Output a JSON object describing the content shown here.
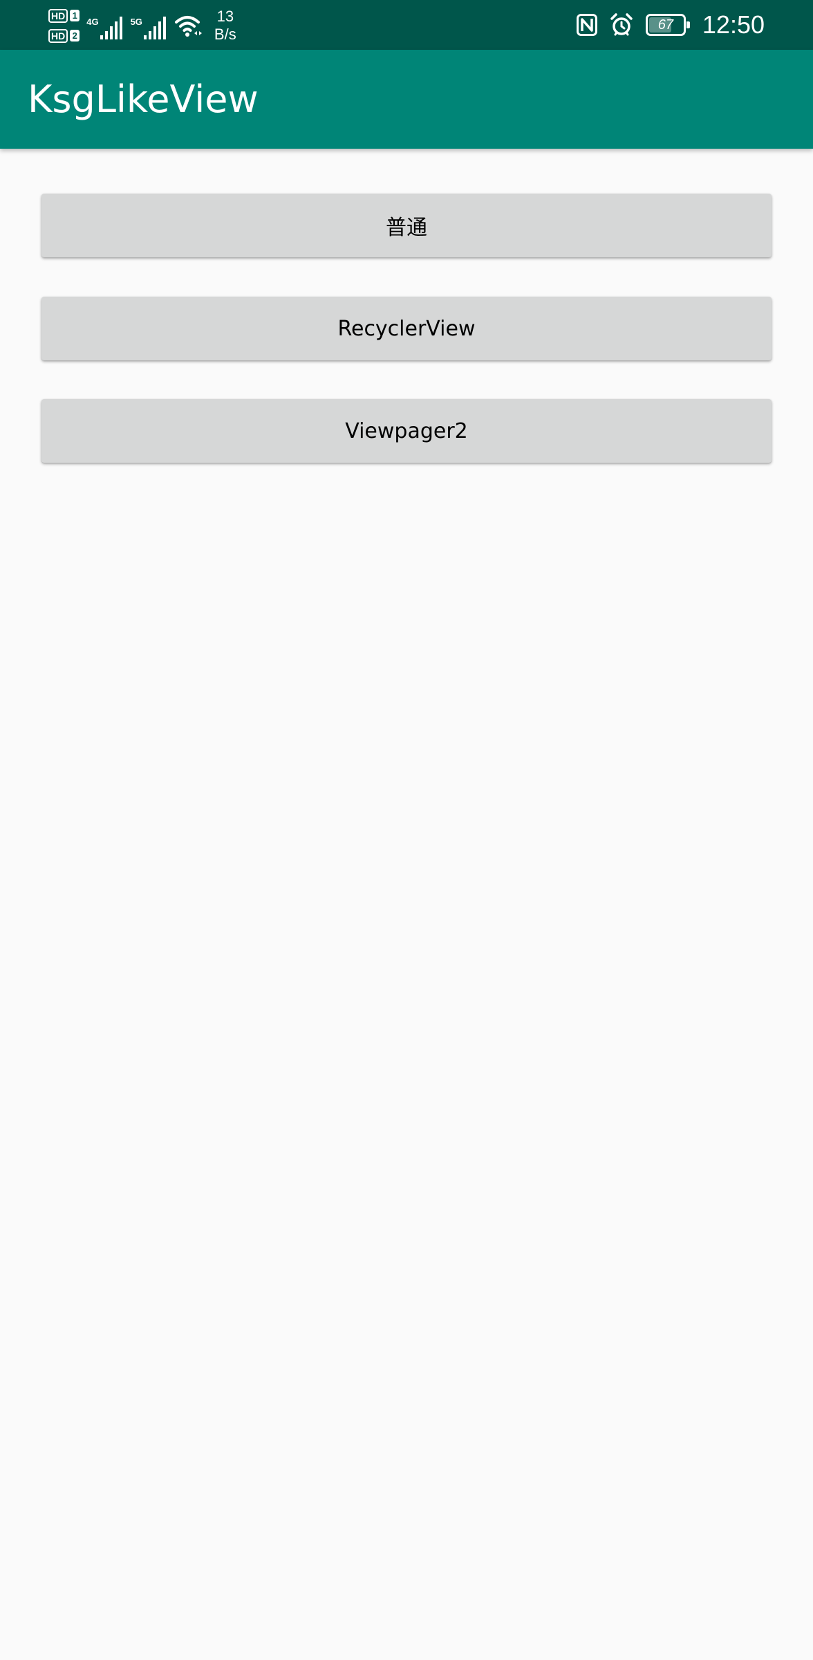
{
  "status_bar": {
    "sim1_badge": "HD",
    "sim1_num": "1",
    "sim2_badge": "HD",
    "sim2_num": "2",
    "net1": "4G",
    "net2": "5G",
    "speed_value": "13",
    "speed_unit": "B/s",
    "battery_level": "67",
    "battery_fraction": 0.67,
    "time": "12:50",
    "icons": [
      "nfc-icon",
      "alarm-icon",
      "wifi-icon",
      "signal-icon",
      "battery-icon"
    ]
  },
  "app_bar": {
    "title": "KsgLikeView"
  },
  "buttons": [
    {
      "label": "普通"
    },
    {
      "label": "RecyclerView"
    },
    {
      "label": "Viewpager2"
    }
  ],
  "colors": {
    "status_bar": "#00564b",
    "app_bar": "#008577",
    "background": "#fafafa",
    "button": "#d6d7d7"
  }
}
